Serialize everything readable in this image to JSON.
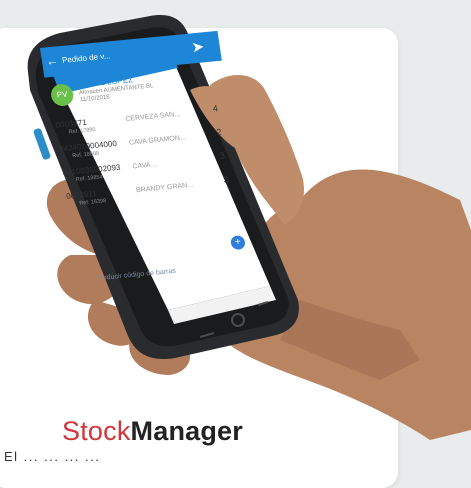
{
  "app": {
    "title": "Pedido de v...",
    "customer": {
      "initials": "PV",
      "name": "ANGEL LOPEZ",
      "line1": "Almacen AUMENTANTE BL",
      "line2": "11/10/2018"
    },
    "items": [
      {
        "code": "0003471",
        "ref": "Ref. 17890",
        "desc": "CERVEZA SAN...",
        "qty": "4"
      },
      {
        "code": "8424919004000",
        "ref": "Ref. 18808",
        "desc": "CAVA GRAMON...",
        "qty": "2"
      },
      {
        "code": "8410036002093",
        "ref": "Ref. 18854",
        "desc": "CAVA ...",
        "qty": "3"
      },
      {
        "code": "0002811",
        "ref": "Ref. 16398",
        "desc": "BRANDY GRAN...",
        "qty": "3"
      }
    ],
    "barcode_placeholder": "Introducir código de barras",
    "fab_label": "+"
  },
  "brand": {
    "part1": "Stock",
    "part2": "Manager"
  },
  "caption": "El ... ... ... ...",
  "icons": {
    "back": "arrow-left-icon",
    "send": "send-icon",
    "status": "status-bar-icons"
  },
  "colors": {
    "accent": "#1e86d6",
    "brand_red": "#d0363a",
    "avatar_green": "#6abf4b"
  }
}
